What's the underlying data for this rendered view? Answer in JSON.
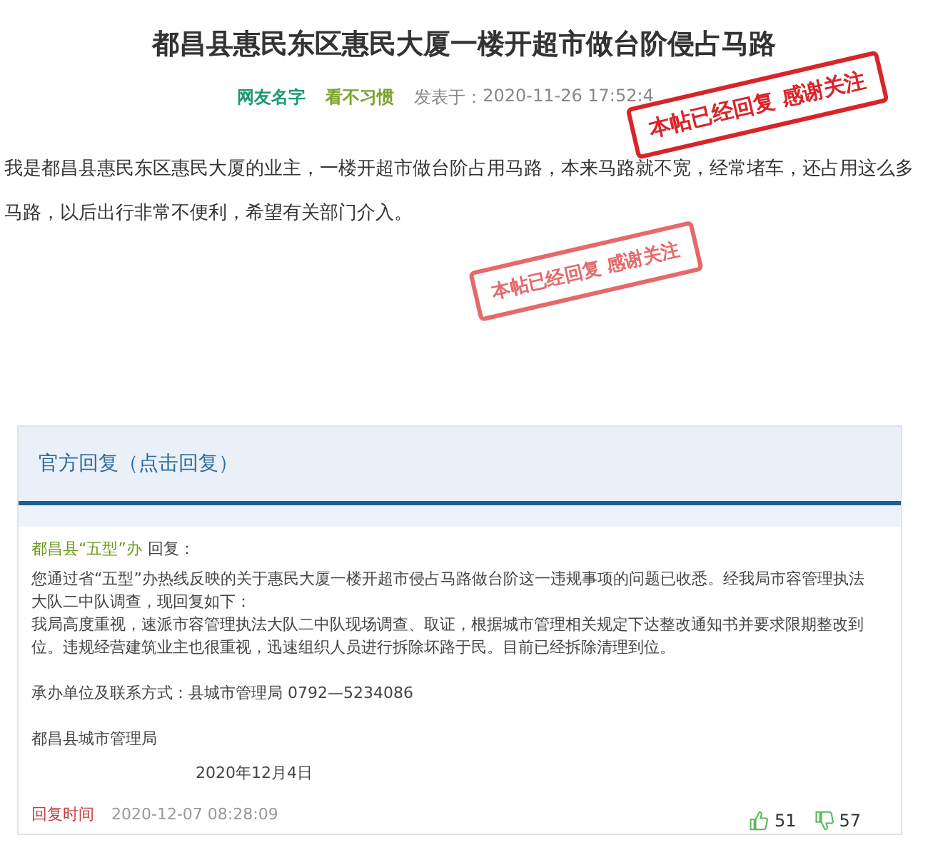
{
  "post": {
    "title": "都昌县惠民东区惠民大厦一楼开超市做台阶侵占马路",
    "author": "网友名字",
    "category": "看不习惯",
    "posted_label": "发表于：",
    "posted_time": "2020-11-26 17:52:4",
    "body": "我是都昌县惠民东区惠民大厦的业主，一楼开超市做台阶占用马路，本来马路就不宽，经常堵车，还占用这么多马路，以后出行非常不便利，希望有关部门介入。"
  },
  "stamps": [
    {
      "text": "本帖已经回复 感谢关注"
    },
    {
      "text": "本帖已经回复 感谢关注"
    }
  ],
  "reply": {
    "header": "官方回复（点击回复）",
    "office": "都昌县“五型”办",
    "reply_word": "回复：",
    "paragraphs": [
      "您通过省“五型”办热线反映的关于惠民大厦一楼开超市侵占马路做台阶这一违规事项的问题已收悉。经我局市容管理执法大队二中队调查，现回复如下：",
      "我局高度重视，速派市容管理执法大队二中队现场调查、取证，根据城市管理相关规定下达整改通知书并要求限期整改到位。违规经营建筑业主也很重视，迅速组织人员进行拆除坏路于民。目前已经拆除清理到位。"
    ],
    "contact": "承办单位及联系方式：县城市管理局  0792—5234086",
    "signature": "都昌县城市管理局",
    "date": "2020年12月4日",
    "time_label": "回复时间",
    "time": "2020-12-07 08:28:09",
    "likes": "51",
    "dislikes": "57"
  }
}
